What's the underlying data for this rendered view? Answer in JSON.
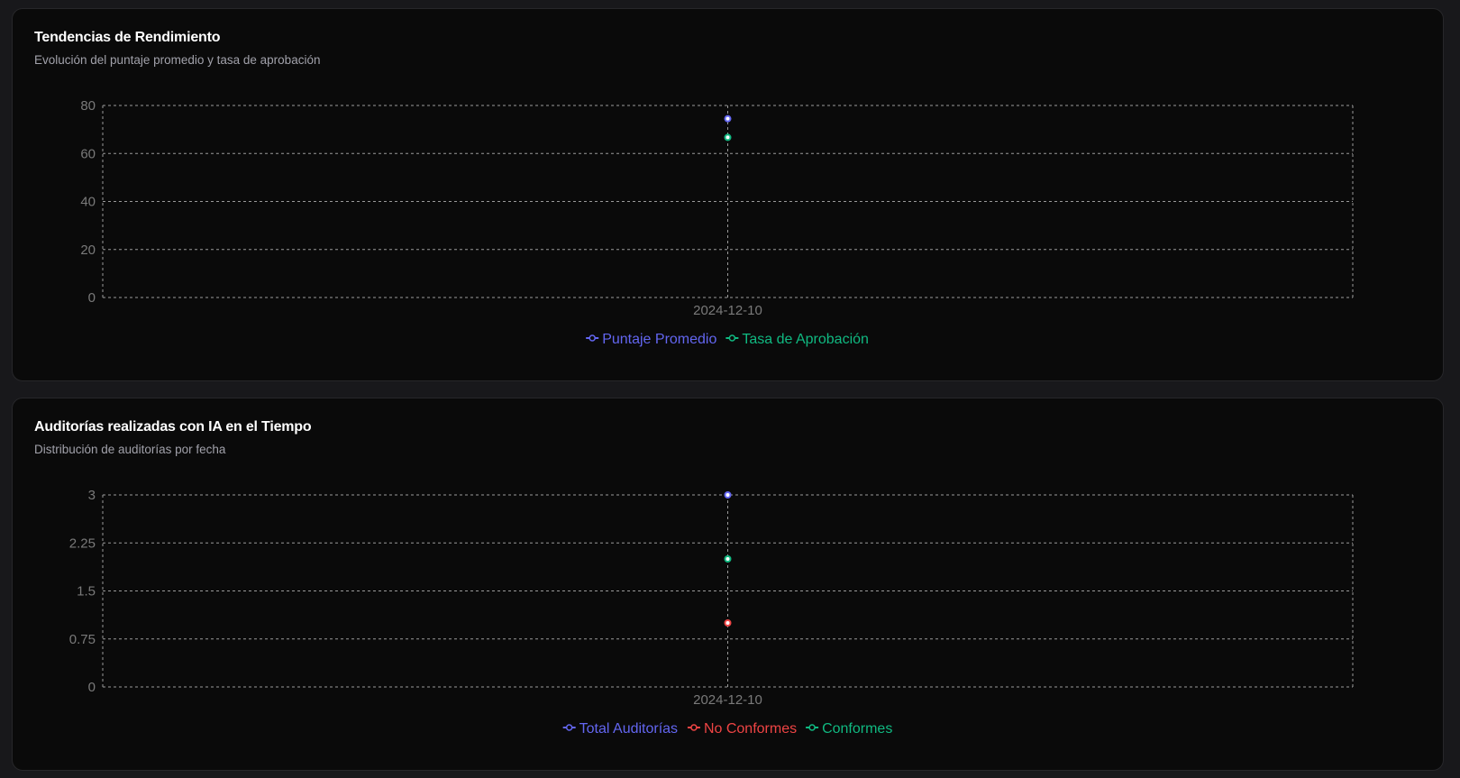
{
  "charts": [
    {
      "title": "Tendencias de Rendimiento",
      "subtitle": "Evolución del puntaje promedio y tasa de aprobación"
    },
    {
      "title": "Auditorías realizadas con IA en el Tiempo",
      "subtitle": "Distribución de auditorías por fecha"
    }
  ],
  "chart_data": [
    {
      "type": "line",
      "categories": [
        "2024-12-10"
      ],
      "ylim": [
        0,
        80
      ],
      "yticks": [
        "0",
        "20",
        "40",
        "60",
        "80"
      ],
      "grid": true,
      "legend": "bottom",
      "series": [
        {
          "name": "Puntaje Promedio",
          "values": [
            74.5
          ],
          "color": "#6366f1"
        },
        {
          "name": "Tasa de Aprobación",
          "values": [
            66.7
          ],
          "color": "#10b981"
        }
      ]
    },
    {
      "type": "line",
      "categories": [
        "2024-12-10"
      ],
      "ylim": [
        0,
        3
      ],
      "yticks": [
        "0",
        "0.75",
        "1.5",
        "2.25",
        "3"
      ],
      "grid": true,
      "legend": "bottom",
      "series": [
        {
          "name": "Total Auditorías",
          "values": [
            3
          ],
          "color": "#6366f1"
        },
        {
          "name": "No Conformes",
          "values": [
            1
          ],
          "color": "#ef4444"
        },
        {
          "name": "Conformes",
          "values": [
            2
          ],
          "color": "#10b981"
        }
      ]
    }
  ]
}
